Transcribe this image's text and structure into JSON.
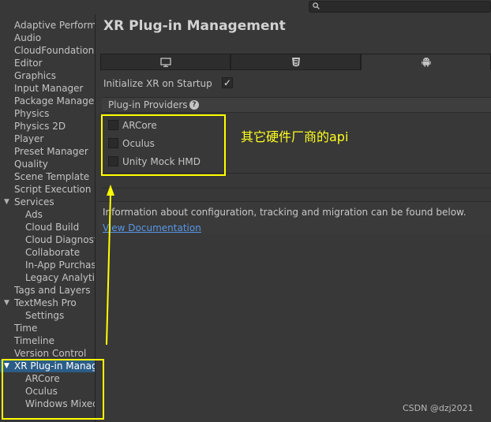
{
  "search": {
    "value": ""
  },
  "sidebar": {
    "items": [
      {
        "label": "Adaptive Performance"
      },
      {
        "label": "Audio"
      },
      {
        "label": "CloudFoundation Info"
      },
      {
        "label": "Editor"
      },
      {
        "label": "Graphics"
      },
      {
        "label": "Input Manager"
      },
      {
        "label": "Package Manager"
      },
      {
        "label": "Physics"
      },
      {
        "label": "Physics 2D"
      },
      {
        "label": "Player"
      },
      {
        "label": "Preset Manager"
      },
      {
        "label": "Quality"
      },
      {
        "label": "Scene Template"
      },
      {
        "label": "Script Execution Order"
      },
      {
        "label": "Services"
      },
      {
        "label": "Ads"
      },
      {
        "label": "Cloud Build"
      },
      {
        "label": "Cloud Diagnostics"
      },
      {
        "label": "Collaborate"
      },
      {
        "label": "In-App Purchasing"
      },
      {
        "label": "Legacy Analytics"
      },
      {
        "label": "Tags and Layers"
      },
      {
        "label": "TextMesh Pro"
      },
      {
        "label": "Settings"
      },
      {
        "label": "Time"
      },
      {
        "label": "Timeline"
      },
      {
        "label": "Version Control"
      },
      {
        "label": "XR Plug-in Management"
      },
      {
        "label": "ARCore"
      },
      {
        "label": "Oculus"
      },
      {
        "label": "Windows Mixed Reality"
      }
    ]
  },
  "main": {
    "title": "XR Plug-in Management",
    "tabs": [
      {
        "icon": "monitor-icon"
      },
      {
        "icon": "html5-icon"
      },
      {
        "icon": "android-icon"
      }
    ],
    "init_xr_label": "Initialize XR on Startup",
    "init_xr_checked": true,
    "providers_header": "Plug-in Providers",
    "providers": [
      {
        "label": "ARCore",
        "checked": false
      },
      {
        "label": "Oculus",
        "checked": false
      },
      {
        "label": "Unity Mock HMD",
        "checked": false
      }
    ],
    "info_text": "Information about configuration, tracking and migration can be found below.",
    "info_link": "View Documentation"
  },
  "annotation": {
    "text": "其它硬件厂商的api",
    "color": "#ffff00"
  },
  "watermark": "CSDN @dzj2021",
  "colors": {
    "selection": "#2c5d87",
    "link": "#5896e8",
    "background": "#383838"
  }
}
